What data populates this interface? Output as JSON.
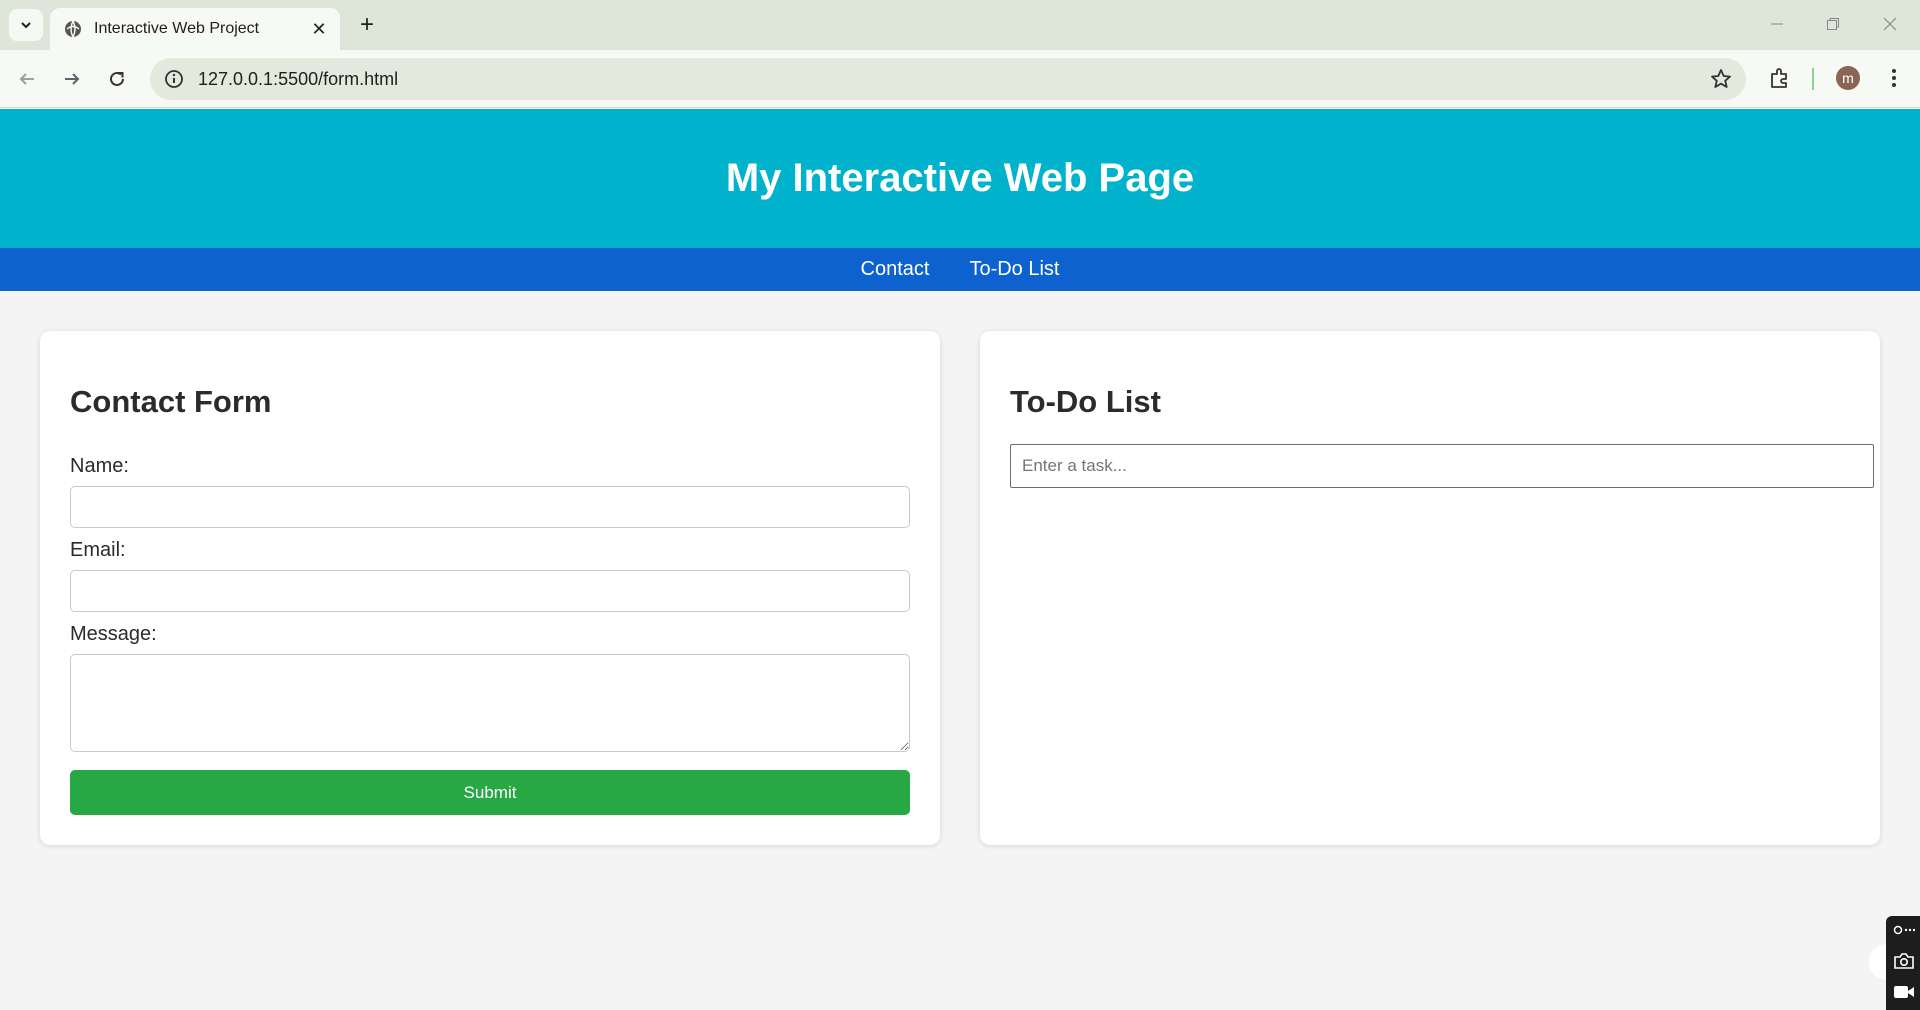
{
  "browser": {
    "tab_title": "Interactive Web Project",
    "url": "127.0.0.1:5500/form.html",
    "profile_initial": "m"
  },
  "page": {
    "heading": "My Interactive Web Page",
    "nav": [
      "Contact",
      "To-Do List"
    ]
  },
  "contact_form": {
    "title": "Contact Form",
    "name_label": "Name:",
    "email_label": "Email:",
    "message_label": "Message:",
    "submit_label": "Submit"
  },
  "todo": {
    "title": "To-Do List",
    "placeholder": "Enter a task..."
  },
  "colors": {
    "header_bg": "#00b2cc",
    "nav_bg": "#0d62cf",
    "submit_bg": "#28a745"
  }
}
